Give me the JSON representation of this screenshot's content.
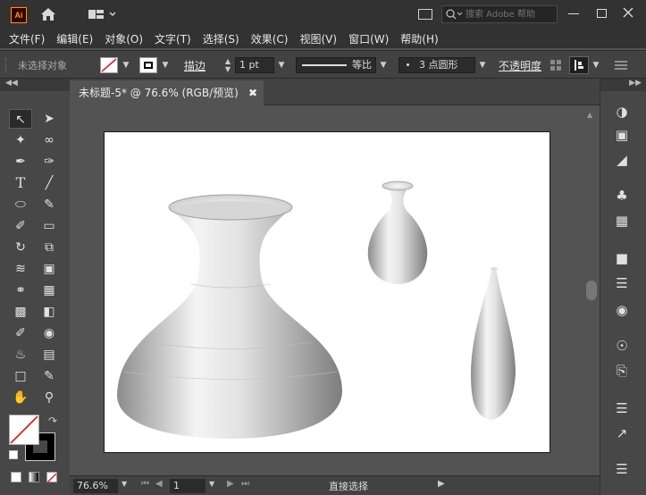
{
  "app": {
    "logo_text": "Ai"
  },
  "search": {
    "placeholder": "搜索 Adobe 帮助"
  },
  "menu": [
    "文件(F)",
    "编辑(E)",
    "对象(O)",
    "文字(T)",
    "选择(S)",
    "效果(C)",
    "视图(V)",
    "窗口(W)",
    "帮助(H)"
  ],
  "control": {
    "selection_status": "未选择对象",
    "stroke_label": "描边",
    "stroke_value": "1 pt",
    "stroke_profile": "等比",
    "brush": "3 点圆形",
    "opacity_label": "不透明度"
  },
  "document": {
    "tab_title": "未标题-5* @ 76.6% (RGB/预览)"
  },
  "status": {
    "zoom": "76.6%",
    "artboard_num": "1",
    "tool_name": "直接选择"
  },
  "colors": {
    "accent": "#ff9a00",
    "ui_dark": "#323232",
    "ui_panel": "#474747",
    "canvas": "#535353"
  }
}
